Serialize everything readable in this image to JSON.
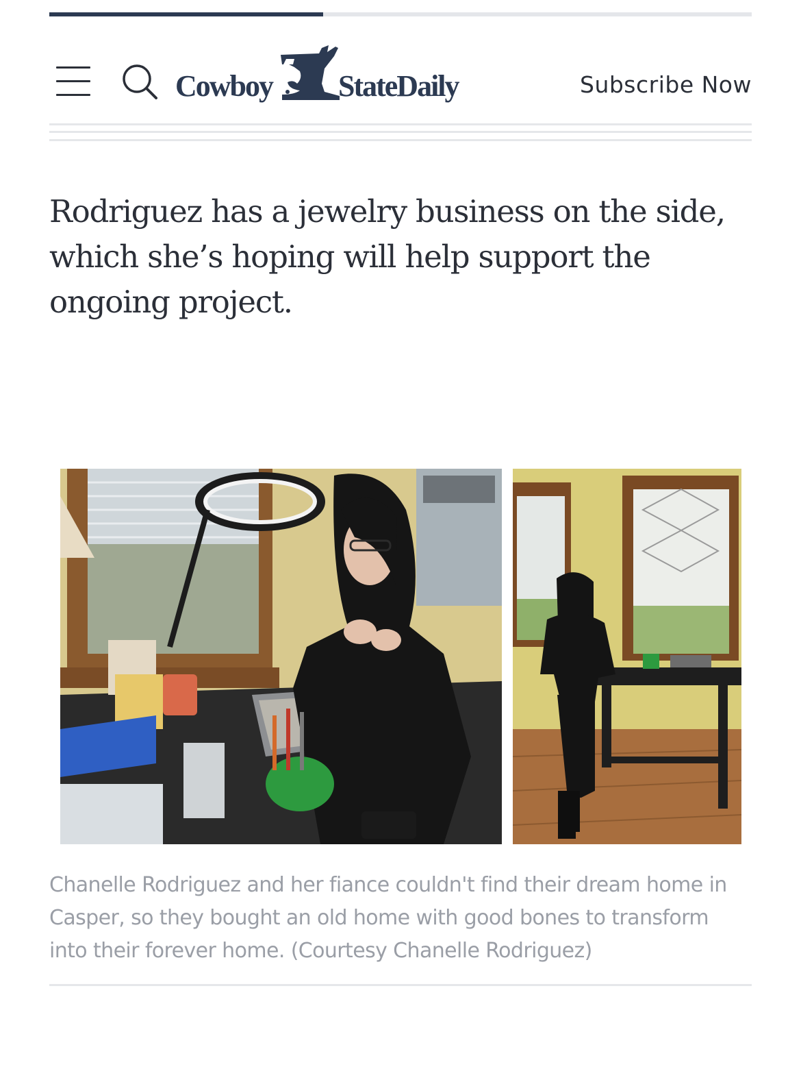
{
  "reading_progress": 0.39,
  "header": {
    "logo": {
      "left_word": "Cowboy",
      "right_word": "StateDaily",
      "mark_icon": "wyoming-bucking-horse-icon"
    },
    "menu_icon": "hamburger-menu-icon",
    "search_icon": "search-icon",
    "subscribe_label": "Subscribe Now"
  },
  "article": {
    "paragraph": "Rodriguez has a jewelry business on the side, which she’s hoping will help support the ongoing project.",
    "photo": {
      "caption": "Chanelle Rodriguez and her fiance couldn't find their dream home in Casper, so they bought an old home with good bones to transform into their forever home. (Courtesy Chanelle Rodriguez)"
    }
  },
  "colors": {
    "brand_navy": "#2c3a52",
    "text_dark": "#2b2f38",
    "caption_gray": "#9a9ea6",
    "rule_gray": "#e5e7ea"
  }
}
